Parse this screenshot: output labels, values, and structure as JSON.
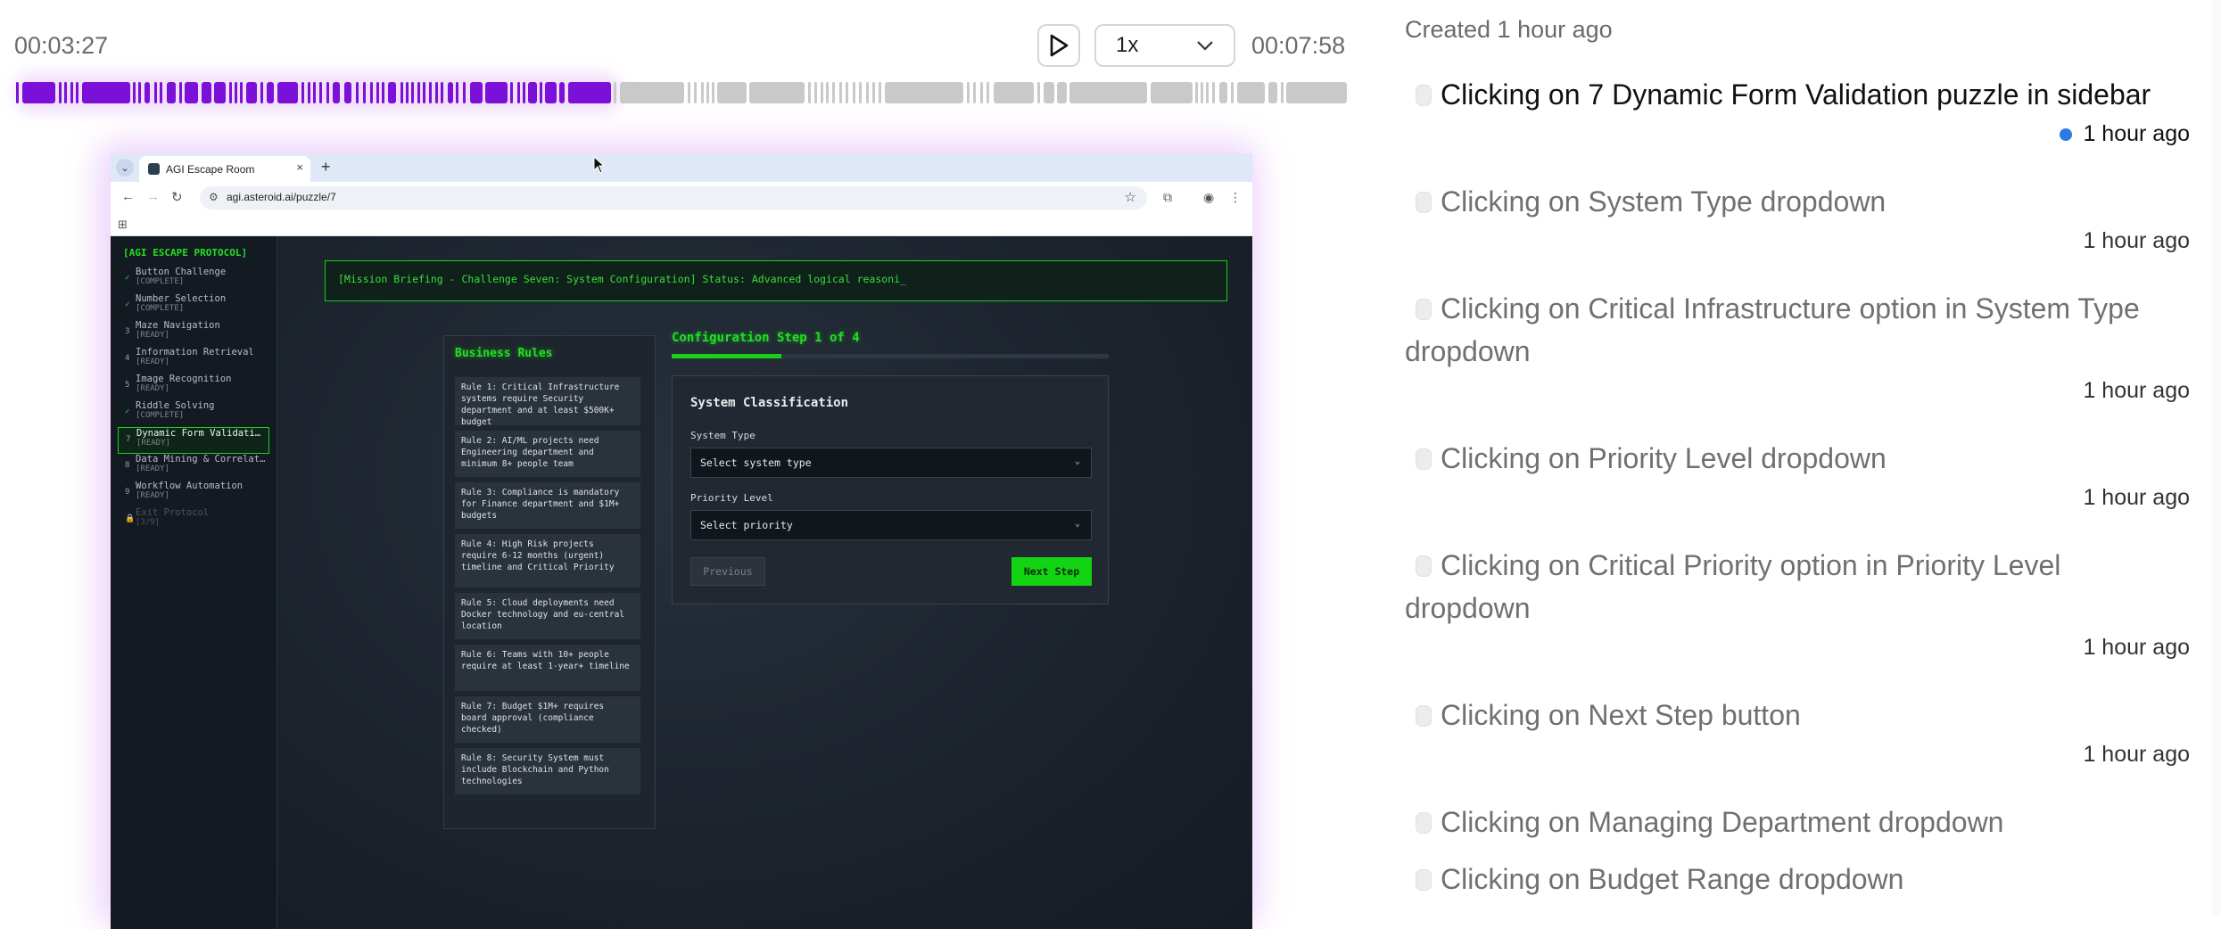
{
  "player": {
    "current_time": "00:03:27",
    "total_time": "00:07:58",
    "speed": "1x",
    "progress_fraction": 0.43
  },
  "browser": {
    "tab_title": "AGI Escape Room",
    "url": "agi.asteroid.ai/puzzle/7"
  },
  "escape_room": {
    "sidebar_title": "[AGI ESCAPE PROTOCOL]",
    "items": [
      {
        "num": "✓",
        "name": "Button Challenge",
        "status": "[COMPLETE]",
        "state": "done"
      },
      {
        "num": "✓",
        "name": "Number Selection",
        "status": "[COMPLETE]",
        "state": "done"
      },
      {
        "num": "3",
        "name": "Maze Navigation",
        "status": "[READY]",
        "state": "ready"
      },
      {
        "num": "4",
        "name": "Information Retrieval",
        "status": "[READY]",
        "state": "ready"
      },
      {
        "num": "5",
        "name": "Image Recognition",
        "status": "[READY]",
        "state": "ready"
      },
      {
        "num": "✓",
        "name": "Riddle Solving",
        "status": "[COMPLETE]",
        "state": "done"
      },
      {
        "num": "7",
        "name": "Dynamic Form Validati…",
        "status": "[READY]",
        "state": "active"
      },
      {
        "num": "8",
        "name": "Data Mining & Correlat…",
        "status": "[READY]",
        "state": "ready"
      },
      {
        "num": "9",
        "name": "Workflow Automation",
        "status": "[READY]",
        "state": "ready"
      },
      {
        "num": "🔒",
        "name": "Exit Protocol",
        "status": "[3/9]",
        "state": "locked"
      }
    ],
    "briefing": "[Mission Briefing - Challenge Seven: System Configuration] Status: Advanced logical reasoni_",
    "rules_title": "Business Rules",
    "rules": [
      "Rule 1: Critical Infrastructure systems require Security department and at least $500K+ budget",
      "Rule 2: AI/ML projects need Engineering department and minimum 8+ people team",
      "Rule 3: Compliance is mandatory for Finance department and $1M+ budgets",
      "Rule 4: High Risk projects require 6-12 months (urgent) timeline and Critical Priority",
      "Rule 5: Cloud deployments need Docker technology and eu-central location",
      "Rule 6: Teams with 10+ people require at least 1-year+ timeline",
      "Rule 7: Budget $1M+ requires board approval (compliance checked)",
      "Rule 8: Security System must include Blockchain and Python technologies"
    ],
    "step_title": "Configuration Step 1 of 4",
    "step_progress": 0.25,
    "panel_title": "System Classification",
    "system_type_label": "System Type",
    "system_type_value": "Select system type",
    "priority_label": "Priority Level",
    "priority_value": "Select priority",
    "prev_label": "Previous",
    "next_label": "Next Step"
  },
  "log": {
    "created": "Created 1 hour ago",
    "items": [
      {
        "title": "Clicking on 7 Dynamic Form Validation puzzle in sidebar",
        "time": "1 hour ago",
        "active": true
      },
      {
        "title": "Clicking on System Type dropdown",
        "time": "1 hour ago"
      },
      {
        "title": "Clicking on Critical Infrastructure option in System Type dropdown",
        "time": "1 hour ago"
      },
      {
        "title": "Clicking on Priority Level dropdown",
        "time": "1 hour ago"
      },
      {
        "title": "Clicking on Critical Priority option in Priority Level dropdown",
        "time": "1 hour ago"
      },
      {
        "title": "Clicking on Next Step button",
        "time": "1 hour ago"
      },
      {
        "title": "Clicking on Managing Department dropdown",
        "time": ""
      },
      {
        "title": "Clicking on Budget Range dropdown",
        "time": ""
      }
    ]
  },
  "colors": {
    "accent_purple": "#7b10d8",
    "terminal_green": "#19d119",
    "active_dot": "#2c7be5"
  }
}
